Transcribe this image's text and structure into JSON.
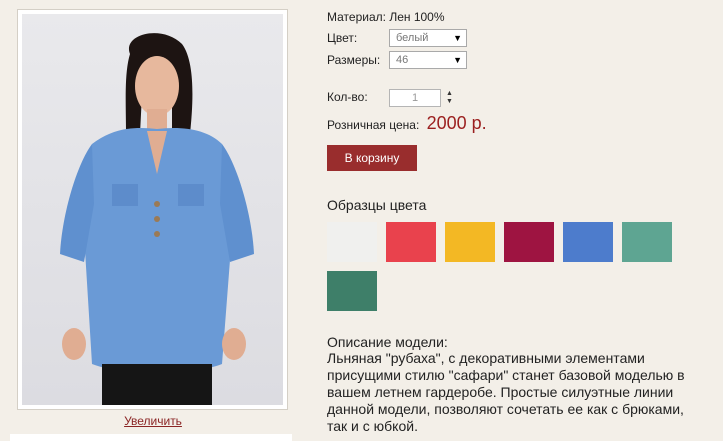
{
  "product": {
    "material_label": "Материал:",
    "material_value": "Лен 100%",
    "color_label": "Цвет:",
    "color_value": "белый",
    "size_label": "Размеры:",
    "size_value": "46",
    "qty_label": "Кол-во:",
    "qty_value": "1",
    "price_label": "Розничная цена:",
    "price_value": "2000 р.",
    "cart_button": "В корзину",
    "zoom_link": "Увеличить"
  },
  "swatches": {
    "title": "Образцы цвета",
    "colors": [
      "#f0f0ee",
      "#e9424d",
      "#f3b824",
      "#9e1441",
      "#4d7ccc",
      "#5ea592",
      "#3e7f69"
    ]
  },
  "description": {
    "title": "Описание модели:",
    "text": "Льняная \"рубаха\", с декоративными элементами присущими стилю \"сафари\" станет базовой моделью в вашем летнем гардеробе. Простые силуэтные линии данной модели, позволяют сочетать ее как с брюками, так и с юбкой."
  }
}
